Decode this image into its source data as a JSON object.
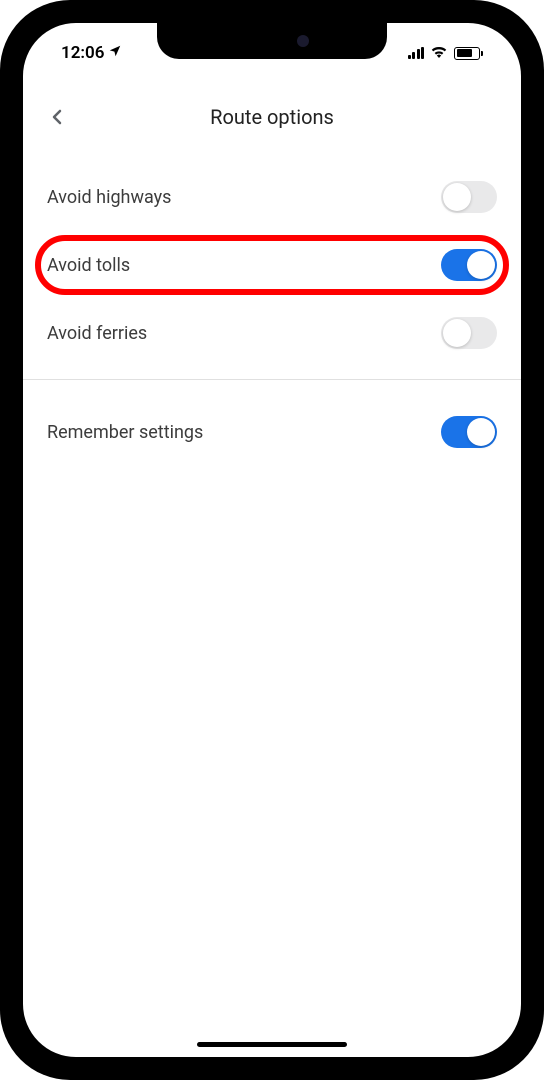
{
  "status_bar": {
    "time": "12:06",
    "location_active": true
  },
  "header": {
    "title": "Route options"
  },
  "settings": [
    {
      "key": "avoid-highways",
      "label": "Avoid highways",
      "enabled": false,
      "highlighted": false
    },
    {
      "key": "avoid-tolls",
      "label": "Avoid tolls",
      "enabled": true,
      "highlighted": true
    },
    {
      "key": "avoid-ferries",
      "label": "Avoid ferries",
      "enabled": false,
      "highlighted": false
    }
  ],
  "remember": {
    "label": "Remember settings",
    "enabled": true
  },
  "colors": {
    "toggle_on": "#1a73e8",
    "toggle_off": "#e9e9ea",
    "highlight": "#ff0000"
  }
}
